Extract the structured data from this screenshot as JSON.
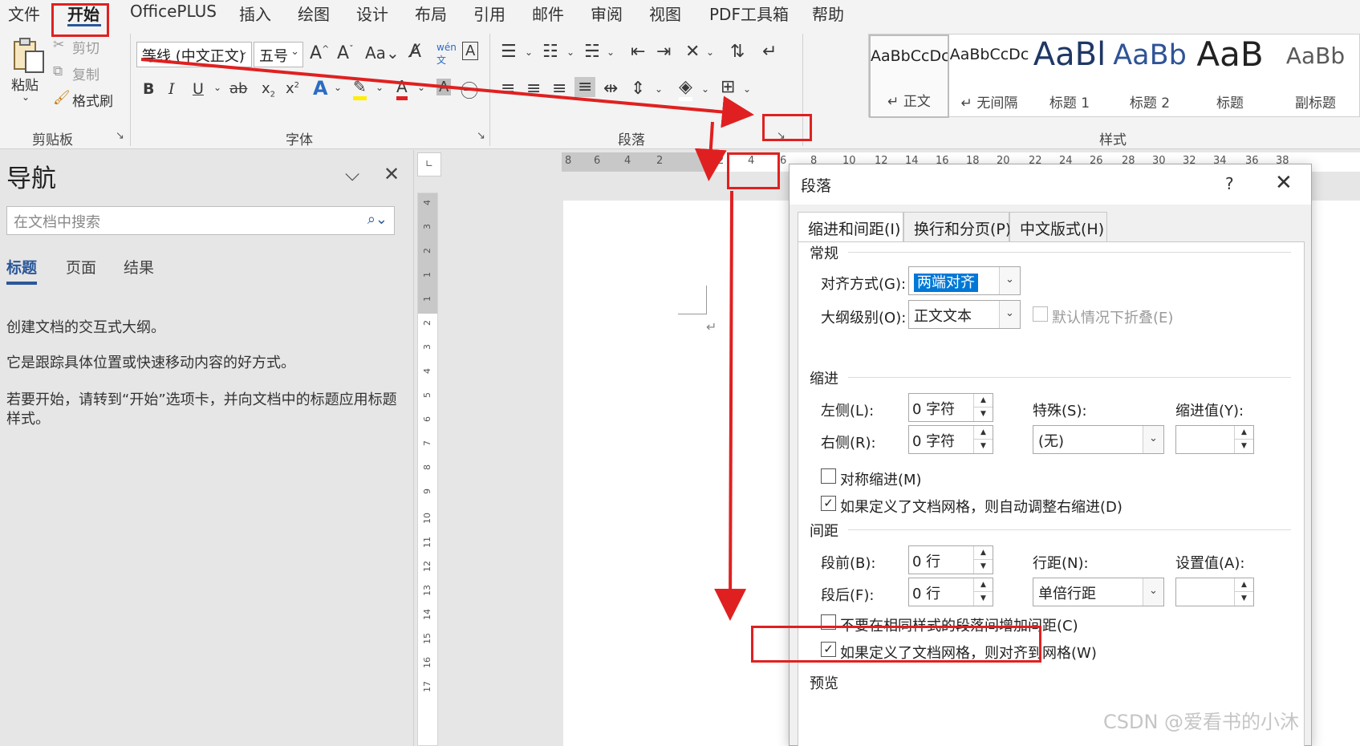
{
  "menu": {
    "tabs": [
      "文件",
      "开始",
      "OfficePLUS",
      "插入",
      "绘图",
      "设计",
      "布局",
      "引用",
      "邮件",
      "审阅",
      "视图",
      "PDF工具箱",
      "帮助"
    ]
  },
  "ribbon": {
    "clipboard": {
      "paste": "粘贴",
      "cut": "剪切",
      "copy": "复制",
      "format_painter": "格式刷",
      "label": "剪贴板"
    },
    "font": {
      "font_name": "等线 (中文正文)",
      "font_size": "五号",
      "label": "字体"
    },
    "paragraph": {
      "label": "段落"
    },
    "styles": {
      "label": "样式",
      "items": [
        {
          "sample": "AaBbCcDc",
          "name": "↵ 正文"
        },
        {
          "sample": "AaBbCcDc",
          "name": "↵ 无间隔"
        },
        {
          "sample": "AaBl",
          "name": "标题 1"
        },
        {
          "sample": "AaBb",
          "name": "标题 2"
        },
        {
          "sample": "AaB",
          "name": "标题"
        },
        {
          "sample": "AaBb",
          "name": "副标题"
        }
      ]
    }
  },
  "nav": {
    "title": "导航",
    "search_placeholder": "在文档中搜索",
    "tabs": [
      "标题",
      "页面",
      "结果"
    ],
    "messages": [
      "创建文档的交互式大纲。",
      "它是跟踪具体位置或快速移动内容的好方式。",
      "若要开始，请转到“开始”选项卡，并向文档中的标题应用标题样式。"
    ]
  },
  "ruler": {
    "h_numbers": [
      "8",
      "6",
      "4",
      "2",
      "2",
      "4",
      "6",
      "8",
      "10",
      "12",
      "14",
      "16",
      "18",
      "20",
      "22",
      "24",
      "26",
      "28",
      "30",
      "32",
      "34",
      "36",
      "38"
    ],
    "v_numbers": [
      "4",
      "3",
      "2",
      "1",
      "1",
      "2",
      "3",
      "4",
      "5",
      "6",
      "7",
      "8",
      "9",
      "10",
      "11",
      "12",
      "13",
      "14",
      "15",
      "16",
      "17"
    ]
  },
  "dialog": {
    "title": "段落",
    "help": "?",
    "tabs": [
      "缩进和间距(I)",
      "换行和分页(P)",
      "中文版式(H)"
    ],
    "general": {
      "section": "常规",
      "alignment_label": "对齐方式(G):",
      "alignment_value": "两端对齐",
      "outline_label": "大纲级别(O):",
      "outline_value": "正文文本",
      "collapse_label": "默认情况下折叠(E)"
    },
    "indent": {
      "section": "缩进",
      "left_label": "左侧(L):",
      "left_value": "0 字符",
      "right_label": "右侧(R):",
      "right_value": "0 字符",
      "special_label": "特殊(S):",
      "special_value": "(无)",
      "by_label": "缩进值(Y):",
      "mirror_label": "对称缩进(M)",
      "auto_adjust_label": "如果定义了文档网格，则自动调整右缩进(D)"
    },
    "spacing": {
      "section": "间距",
      "before_label": "段前(B):",
      "before_value": "0 行",
      "after_label": "段后(F):",
      "after_value": "0 行",
      "line_label": "行距(N):",
      "line_value": "单倍行距",
      "at_label": "设置值(A):",
      "no_space_label": "不要在相同样式的段落间增加间距(C)",
      "snap_grid_label": "如果定义了文档网格，则对齐到网格(W)"
    },
    "preview": {
      "section": "预览"
    }
  },
  "annotation_color": "#e02020",
  "watermark": "CSDN @爱看书的小沐"
}
